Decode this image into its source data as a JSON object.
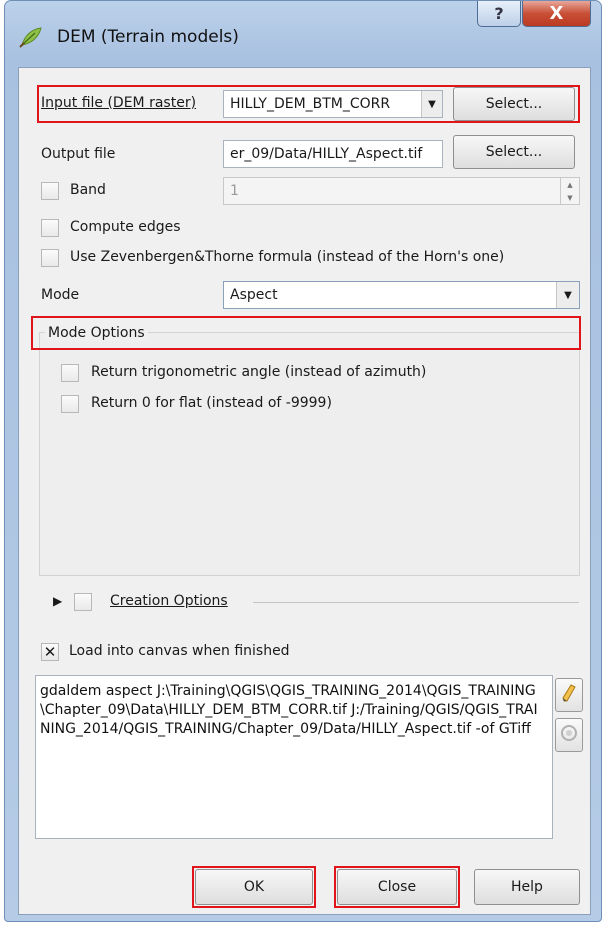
{
  "window": {
    "title": "DEM (Terrain models)",
    "help_glyph": "?",
    "close_glyph": "X"
  },
  "input_file": {
    "label": "Input file (DEM raster)",
    "value": "HILLY_DEM_BTM_CORR",
    "select_label": "Select..."
  },
  "output_file": {
    "label": "Output file",
    "value": "er_09/Data/HILLY_Aspect.tif",
    "select_label": "Select..."
  },
  "band": {
    "label": "Band",
    "value": "1",
    "checked": false
  },
  "compute_edges": {
    "label": "Compute edges",
    "checked": false
  },
  "zevenbergen": {
    "label": "Use Zevenbergen&Thorne formula (instead of the Horn's one)",
    "checked": false
  },
  "mode": {
    "label": "Mode",
    "value": "Aspect"
  },
  "mode_options": {
    "title": "Mode Options",
    "trig_label": "Return trigonometric angle (instead of azimuth)",
    "flat_label": "Return 0 for flat (instead of -9999)"
  },
  "creation_options": {
    "label": "Creation Options"
  },
  "load_canvas": {
    "label": "Load into canvas when finished",
    "checked": true
  },
  "command": {
    "text": "gdaldem aspect J:\\Training\\QGIS\\QGIS_TRAINING_2014\\QGIS_TRAINING\\Chapter_09\\Data\\HILLY_DEM_BTM_CORR.tif J:/Training/QGIS/QGIS_TRAINING_2014/QGIS_TRAINING/Chapter_09/Data/HILLY_Aspect.tif -of GTiff"
  },
  "buttons": {
    "ok": "OK",
    "close": "Close",
    "help": "Help"
  },
  "colors": {
    "highlight": "#e0141b",
    "title_bar": "#b5cbe6",
    "close_button": "#c84f36"
  }
}
